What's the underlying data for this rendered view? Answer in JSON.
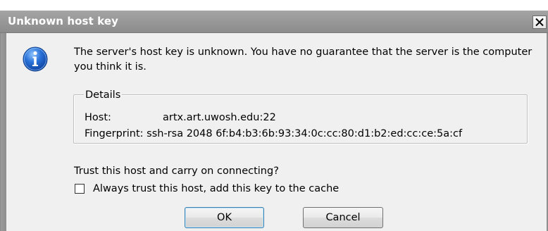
{
  "window": {
    "title": "Unknown host key",
    "close_label": "X"
  },
  "message": {
    "text": "The server's host key is unknown. You have no guarantee that the server is the computer you think it is."
  },
  "details": {
    "legend": "Details",
    "host_label": "Host:",
    "host_value": "artx.art.uwosh.edu:22",
    "fingerprint_label": "Fingerprint:",
    "fingerprint_value": "ssh-rsa 2048 6f:b4:b3:6b:93:34:0c:cc:80:d1:b2:ed:cc:ce:5a:cf"
  },
  "prompt": {
    "question": "Trust this host and carry on connecting?",
    "checkbox_label": "Always trust this host, add this key to the cache",
    "checkbox_checked": false
  },
  "buttons": {
    "ok_label": "OK",
    "cancel_label": "Cancel"
  },
  "icons": {
    "dialog_icon": "information-icon",
    "close_icon": "close-icon"
  },
  "colors": {
    "titlebar": "#999999",
    "dialog_background": "#f0f0f0",
    "info_icon_blue": "#1f5fbf"
  }
}
